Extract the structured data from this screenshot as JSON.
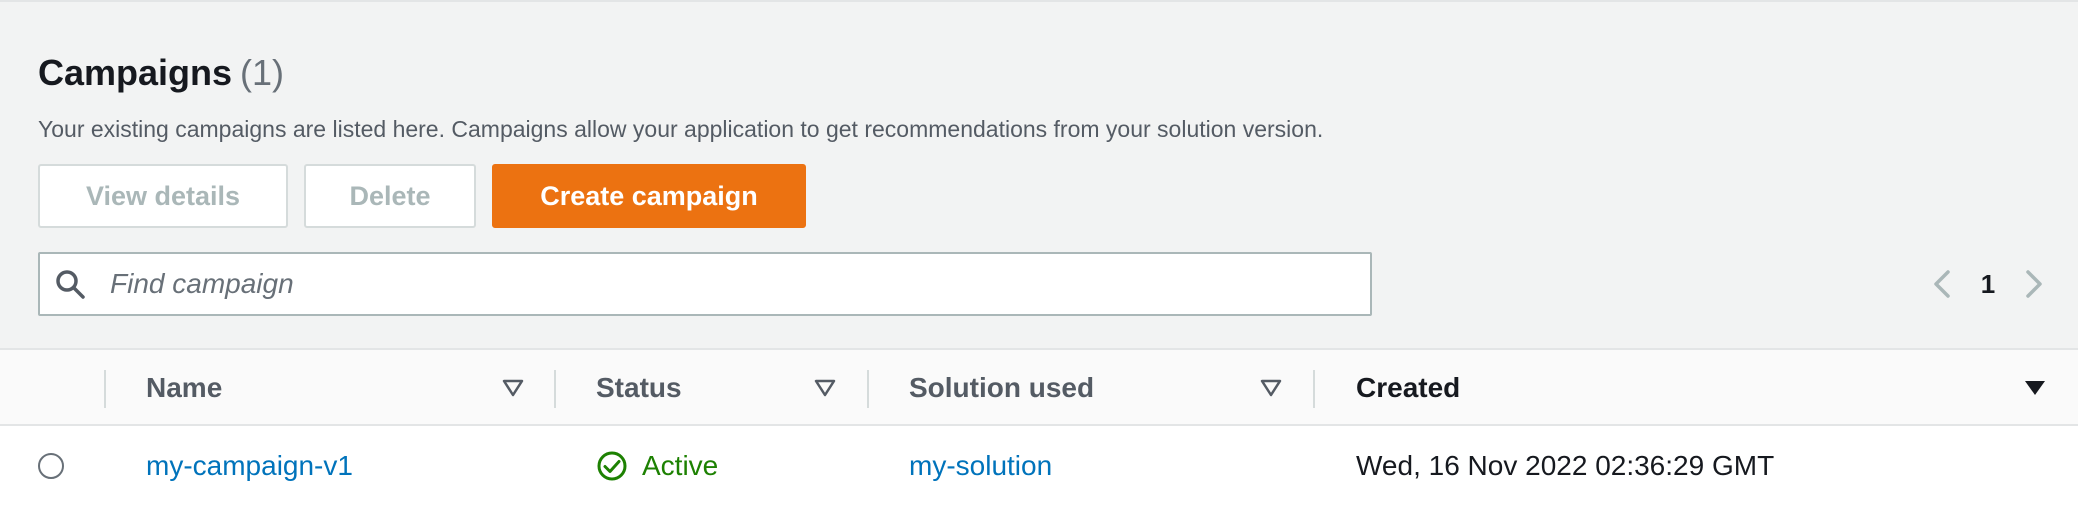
{
  "section": {
    "title": "Campaigns",
    "count": "(1)",
    "description": "Your existing campaigns are listed here. Campaigns allow your application to get recommendations from your solution version."
  },
  "toolbar": {
    "view_details_label": "View details",
    "delete_label": "Delete",
    "create_label": "Create campaign"
  },
  "search": {
    "placeholder": "Find campaign",
    "value": ""
  },
  "pagination": {
    "current_page": "1"
  },
  "table": {
    "columns": [
      {
        "label": "Name",
        "sort": "unsorted"
      },
      {
        "label": "Status",
        "sort": "unsorted"
      },
      {
        "label": "Solution used",
        "sort": "unsorted"
      },
      {
        "label": "Created",
        "sort": "descending"
      }
    ],
    "rows": [
      {
        "name": "my-campaign-v1",
        "status": "Active",
        "solution": "my-solution",
        "created": "Wed, 16 Nov 2022 02:36:29 GMT"
      }
    ]
  },
  "colors": {
    "accent": "#ec7211",
    "link": "#0073bb",
    "success": "#1d8102",
    "panel_bg": "#f2f3f3"
  },
  "icons": {
    "search": "search-icon",
    "prev": "chevron-left-icon",
    "next": "chevron-right-icon",
    "sort_unsorted": "caret-down-outline-icon",
    "sort_descending": "caret-down-filled-icon",
    "status": "check-circle-icon"
  }
}
